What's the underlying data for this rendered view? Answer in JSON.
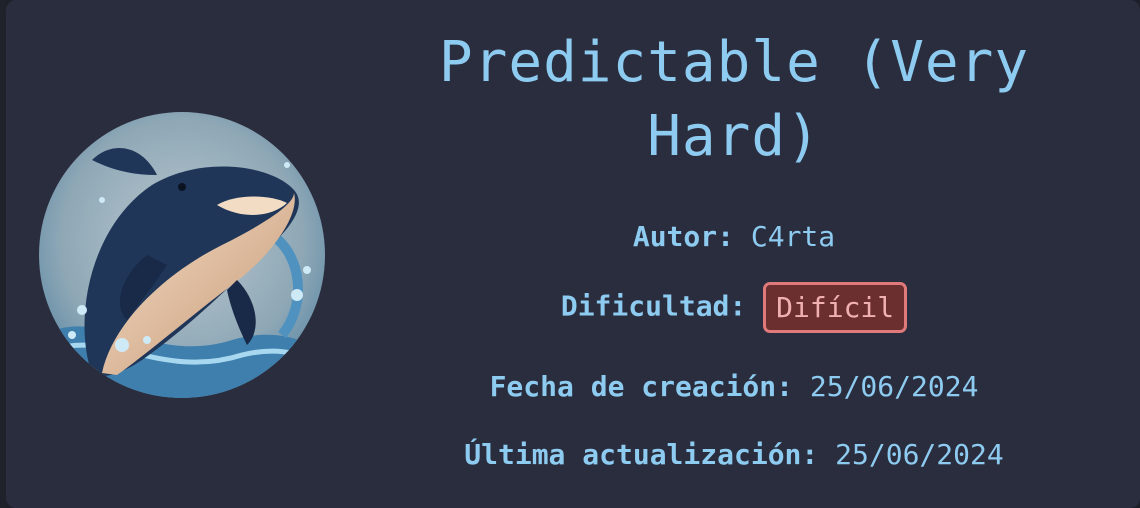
{
  "machine": {
    "title": "Predictable (Very Hard)",
    "author_label": "Autor:",
    "author": "C4rta",
    "difficulty_label": "Dificultad:",
    "difficulty": "Difícil",
    "created_label": "Fecha de creación:",
    "created": "25/06/2024",
    "updated_label": "Última actualización:",
    "updated": "25/06/2024"
  },
  "colors": {
    "background": "#2a2d3e",
    "text": "#8ecbf0",
    "badge_bg": "#6b2f2f",
    "badge_border": "#e07a7a",
    "badge_text": "#f0b0b0"
  },
  "avatar": {
    "icon": "orca-icon"
  }
}
